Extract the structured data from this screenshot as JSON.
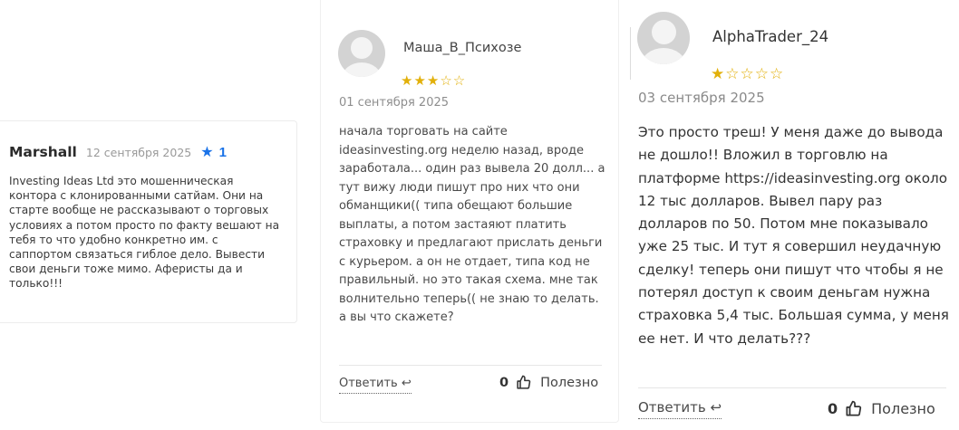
{
  "colors": {
    "accent_blue": "#1a73e8",
    "star_gold": "#e2b00a",
    "avatar_gray": "#d3d3d3"
  },
  "reviews": [
    {
      "author": "Marshall",
      "date": "12 сентября 2025",
      "rating_icon": "star-icon",
      "rating": "1",
      "text": "Investing Ideas Ltd это мошенническая контора с клонированными сатйам. Они на старте вообще не рассказывают о торговых условиях а потом просто по факту вешают на тебя то что удобно конкретно им. с саппортом связаться гиблое дело. Вывести свои деньги тоже мимо. Аферисты да и только!!!"
    },
    {
      "author": "Маша_В_Психозе",
      "stars_filled": 3,
      "stars_total": 5,
      "stars_display": "★★★☆☆",
      "date": "01 сентября 2025",
      "text": "начала торговать на сайте ideasinvesting.org неделю назад, вроде заработала... один раз вывела 20 долл... а тут вижу люди пишут про них что они обманщики(( типа обещают большие выплаты, а потом застаяют платить страховку и предлагают прислать деньги с курьером. а он не отдает, типа код не правильный. но это такая схема. мне так волнительно теперь(( не знаю то делать. а вы что скажете?",
      "reply_label": "Ответить ↩",
      "likes": "0",
      "useful_label": "Полезно"
    },
    {
      "author": "AlphaTrader_24",
      "stars_filled": 1,
      "stars_total": 5,
      "stars_display": "★☆☆☆☆",
      "date": "03 сентября 2025",
      "text": "Это просто треш! У меня даже до вывода не дошло!! Вложил в торговлю на платформе https://ideasinvesting.org около 12 тыс долларов. Вывел пару раз долларов по 50. Потом мне показывало уже 25 тыс. И тут я совершил неудачную сделку! теперь они пишут что чтобы я не потерял доступ к своим деньгам нужна страховка 5,4 тыс. Большая сумма, у меня ее нет. И что делать???",
      "reply_label": "Ответить ↩",
      "likes": "0",
      "useful_label": "Полезно"
    }
  ]
}
